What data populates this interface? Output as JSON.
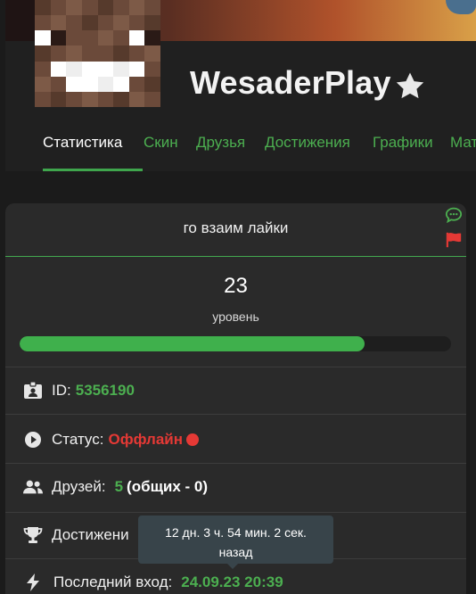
{
  "profile": {
    "username": "WesaderPlay",
    "badge_icon": "star-icon"
  },
  "tabs": [
    {
      "label": "Статистика",
      "active": true
    },
    {
      "label": "Скин"
    },
    {
      "label": "Друзья"
    },
    {
      "label": "Достижения"
    },
    {
      "label": "Графики"
    },
    {
      "label": "Мат"
    }
  ],
  "card": {
    "motto": "го взаим лайки",
    "side_icons": [
      "chat-icon",
      "flag-icon"
    ],
    "level": "23",
    "level_label": "уровень",
    "level_progress": 0.8,
    "rows": {
      "id": {
        "label": "ID:",
        "value": "5356190",
        "icon": "id-badge-icon"
      },
      "status": {
        "label": "Статус:",
        "value": "Оффлайн",
        "icon": "play-circle-icon"
      },
      "friends": {
        "label": "Друзей:",
        "value": "5",
        "extra": "(общих - 0)",
        "icon": "users-icon"
      },
      "achievements": {
        "label": "Достижени",
        "icon": "trophy-icon"
      },
      "last_login": {
        "label": "Последний вход:",
        "value": "24.09.23 20:39",
        "icon": "lightning-icon"
      }
    }
  },
  "tooltip": {
    "line1": "12 дн. 3 ч. 54 мин. 2 сек.",
    "line2": "назад"
  },
  "colors": {
    "accent": "#4caf50",
    "offline": "#e53935",
    "card_bg": "#2a2a2a",
    "page_bg": "#1b1b1b"
  }
}
